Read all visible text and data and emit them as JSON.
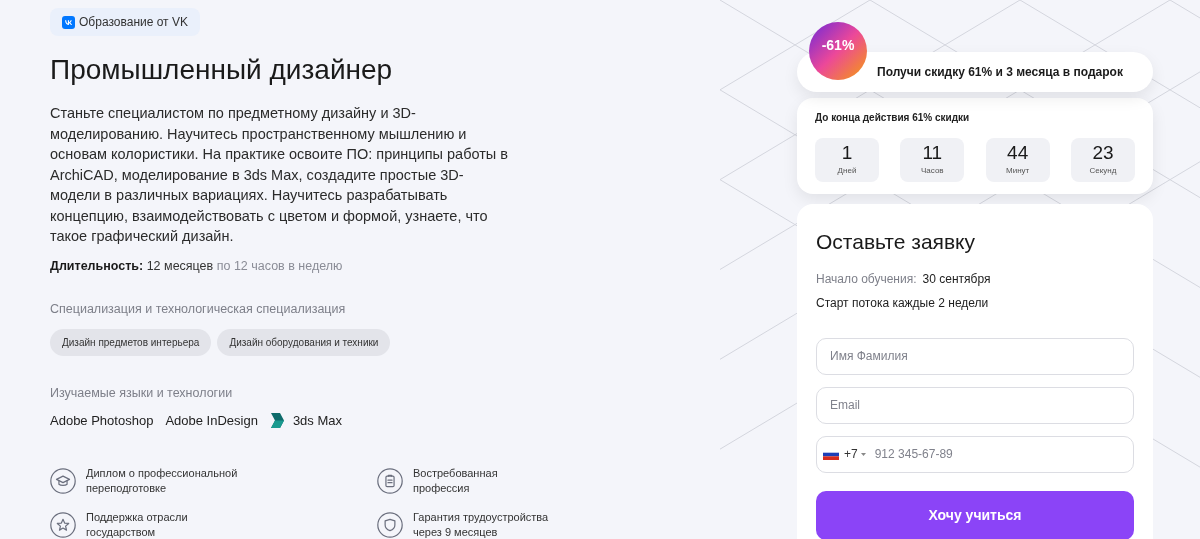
{
  "badge": "Образование от VK",
  "title": "Промышленный дизайнер",
  "description": "Станьте специалистом по предметному дизайну и 3D-моделированию. Научитесь пространственному мышлению и основам колористики. На практике освоите ПО: принципы работы в ArchiCAD, моделирование в 3ds Max, создадите простые 3D-модели в различных вариациях. Научитесь разрабатывать концепцию, взаимодействовать с цветом и формой, узнаете, что такое графический дизайн.",
  "duration": {
    "label": "Длительность:",
    "value": "12 месяцев",
    "note": "по 12 часов в неделю"
  },
  "specializations": {
    "heading": "Специализация и технологическая специализация",
    "tags": [
      "Дизайн предметов интерьера",
      "Дизайн оборудования и техники"
    ]
  },
  "technologies": {
    "heading": "Изучаемые языки и технологии",
    "items": [
      {
        "name": "Adobe Photoshop",
        "kind": "text"
      },
      {
        "name": "Adobe InDesign",
        "kind": "text"
      },
      {
        "name": "3ds Max",
        "kind": "logo"
      }
    ]
  },
  "features": [
    {
      "kind": "diploma",
      "text": "Диплом о профессиональной\nпереподготовке"
    },
    {
      "kind": "clipboard",
      "text": "Востребованная\nпрофессия"
    },
    {
      "kind": "star",
      "text": "Поддержка отрасли\nгосударством"
    },
    {
      "kind": "shield",
      "text": "Гарантия трудоустройства\nчерез 9 месяцев"
    }
  ],
  "promo": {
    "sticker": "-61%",
    "text": "Получи скидку 61% и 3 месяца в подарок"
  },
  "countdown": {
    "title": "До конца действия 61% скидки",
    "units": [
      {
        "value": "1",
        "label": "Дней"
      },
      {
        "value": "11",
        "label": "Часов"
      },
      {
        "value": "44",
        "label": "Минут"
      },
      {
        "value": "23",
        "label": "Секунд"
      }
    ]
  },
  "form": {
    "title": "Оставьте заявку",
    "start_label": "Начало обучения:",
    "start_value": "30 сентября",
    "note": "Старт потока каждые 2 недели",
    "name_placeholder": "Имя Фамилия",
    "email_placeholder": "Email",
    "phone_code": "+7",
    "phone_placeholder": "912 345-67-89",
    "submit": "Хочу учиться"
  }
}
